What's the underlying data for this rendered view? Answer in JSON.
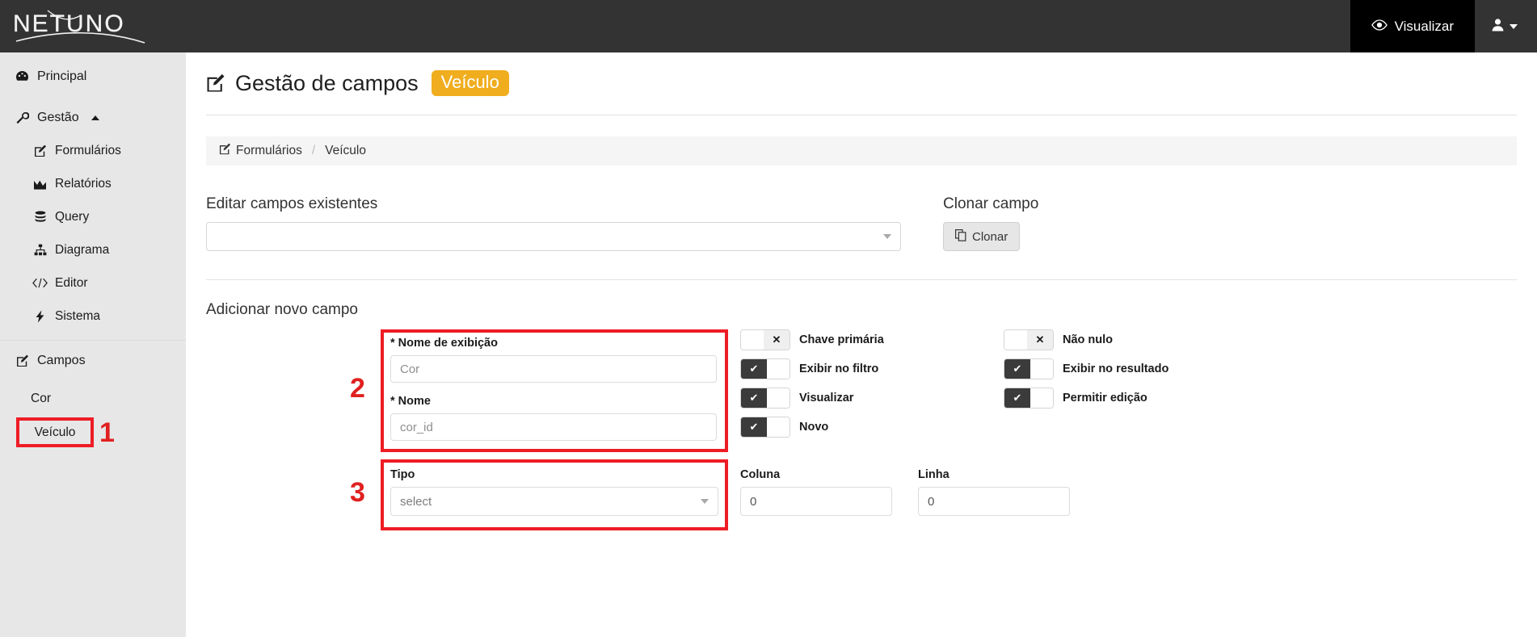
{
  "navbar": {
    "brand": "NETUNO",
    "visualizar_label": "Visualizar",
    "visualizar_icon": "eye-icon",
    "user_icon": "user-icon"
  },
  "sidebar": {
    "items": [
      {
        "label": "Principal",
        "icon": "dashboard-icon",
        "level": 0
      },
      {
        "label": "Gestão",
        "icon": "wrench-icon",
        "level": 0,
        "expanded": true
      },
      {
        "label": "Formulários",
        "icon": "pencil-square-icon",
        "level": 1
      },
      {
        "label": "Relatórios",
        "icon": "chart-area-icon",
        "level": 1
      },
      {
        "label": "Query",
        "icon": "database-icon",
        "level": 1
      },
      {
        "label": "Diagrama",
        "icon": "sitemap-icon",
        "level": 1
      },
      {
        "label": "Editor",
        "icon": "code-icon",
        "level": 1
      },
      {
        "label": "Sistema",
        "icon": "bolt-icon",
        "level": 1
      }
    ],
    "campos": {
      "label": "Campos",
      "icon": "pencil-square-icon"
    },
    "campos_items": [
      {
        "label": "Cor"
      },
      {
        "label": "Veículo",
        "highlighted": true
      }
    ]
  },
  "annotations": [
    {
      "id": "1",
      "text": "1"
    },
    {
      "id": "2",
      "text": "2"
    },
    {
      "id": "3",
      "text": "3"
    }
  ],
  "page": {
    "title": "Gestão de campos",
    "title_icon": "pencil-square-icon",
    "badge": "Veículo",
    "badge_color": "#f0ad1e"
  },
  "breadcrumb": {
    "icon": "pencil-square-icon",
    "root": "Formulários",
    "separator": "/",
    "current": "Veículo"
  },
  "edit_section": {
    "label": "Editar campos existentes",
    "select_value": "",
    "select_placeholder": ""
  },
  "clone_section": {
    "label": "Clonar campo",
    "button_label": "Clonar",
    "button_icon": "copy-icon"
  },
  "add_section": {
    "title": "Adicionar novo campo",
    "fields": {
      "display_name": {
        "label": "* Nome de exibição",
        "value": "Cor"
      },
      "name": {
        "label": "* Nome",
        "value": "cor_id"
      },
      "tipo": {
        "label": "Tipo",
        "value": "select"
      },
      "coluna": {
        "label": "Coluna",
        "value": "0"
      },
      "linha": {
        "label": "Linha",
        "value": "0"
      }
    },
    "toggles_left": [
      {
        "label": "Chave primária",
        "on": false
      },
      {
        "label": "Exibir no filtro",
        "on": true
      },
      {
        "label": "Visualizar",
        "on": true
      },
      {
        "label": "Novo",
        "on": true
      }
    ],
    "toggles_right": [
      {
        "label": "Não nulo",
        "on": false
      },
      {
        "label": "Exibir no resultado",
        "on": true
      },
      {
        "label": "Permitir edição",
        "on": true
      }
    ]
  },
  "colors": {
    "navbar_bg": "#333333",
    "sidebar_bg": "#e7e7e7",
    "accent_badge": "#f0ad1e",
    "annotation_red": "#ee1c25",
    "toggle_on": "#3b3b3b"
  }
}
